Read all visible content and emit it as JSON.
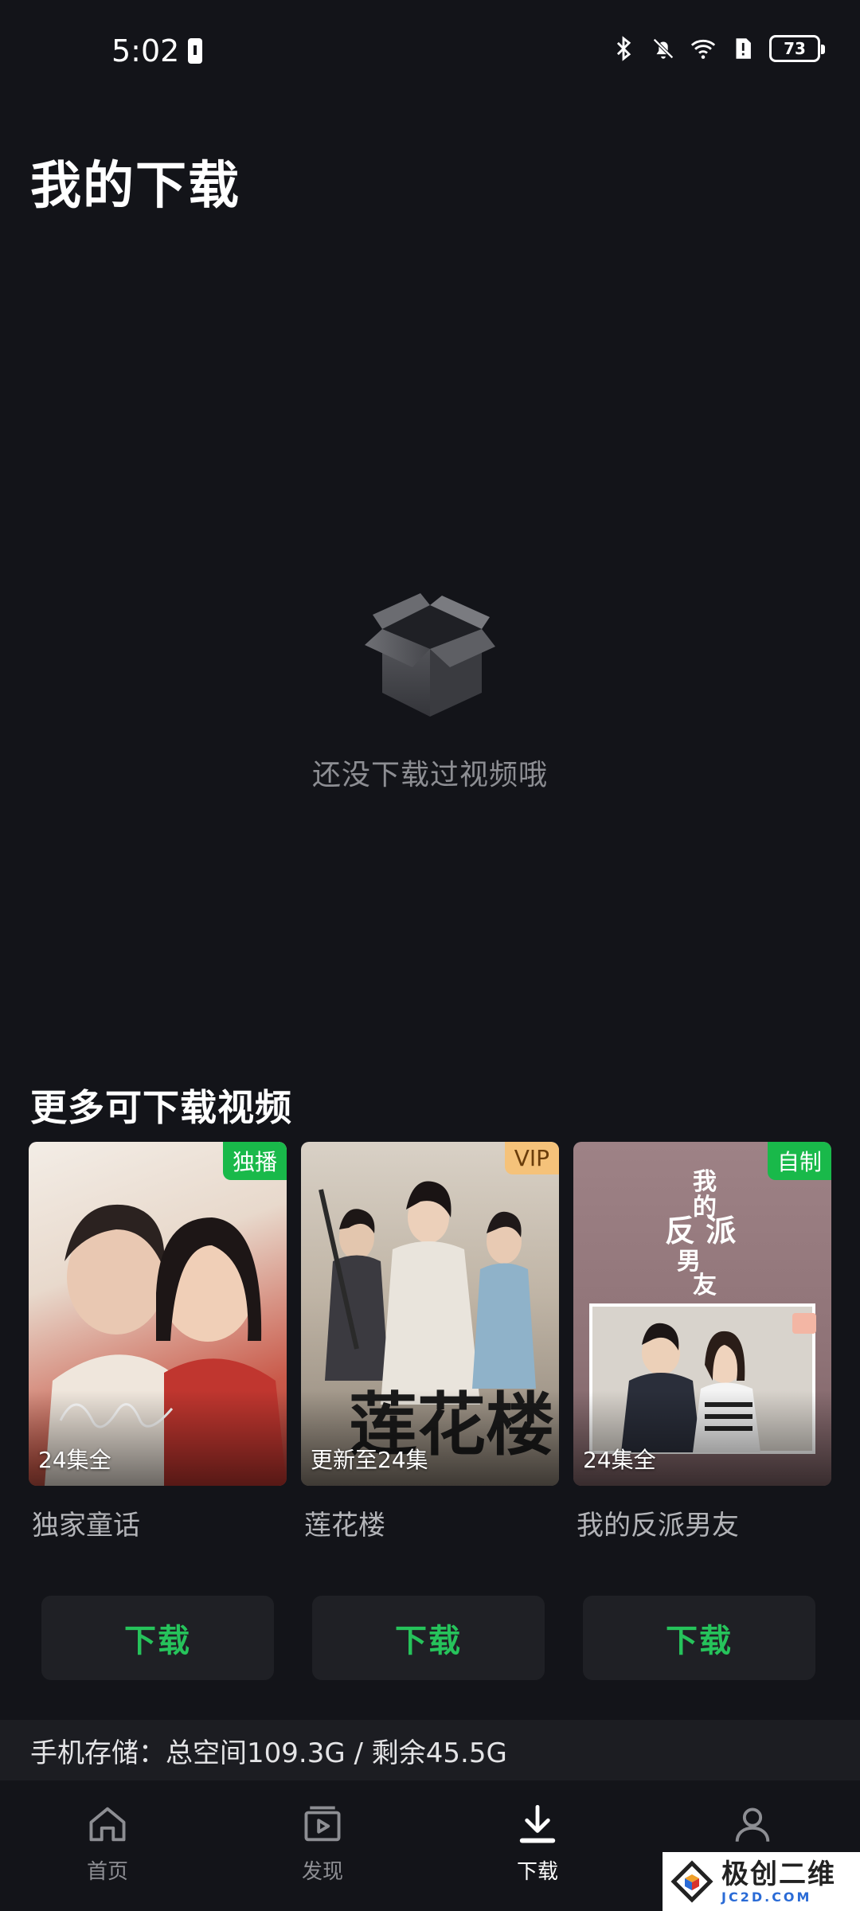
{
  "status": {
    "time": "5:02",
    "battery": "73"
  },
  "page": {
    "title": "我的下载"
  },
  "empty": {
    "message": "还没下载过视频哦"
  },
  "section": {
    "title": "更多可下载视频"
  },
  "cards": [
    {
      "title": "独家童话",
      "badge": "独播",
      "badge_color": "#19b94a",
      "episodes": "24集全"
    },
    {
      "title": "莲花楼",
      "badge": "VIP",
      "badge_color": "#f5c27a",
      "episodes": "更新至24集"
    },
    {
      "title": "我的反派男友",
      "badge": "自制",
      "badge_color": "#19b94a",
      "episodes": "24集全"
    }
  ],
  "download_buttons": [
    "下载",
    "下载",
    "下载"
  ],
  "storage": {
    "text": "手机存储：总空间109.3G / 剩余45.5G"
  },
  "tabs": [
    {
      "label": "首页",
      "icon": "home-icon",
      "active": false
    },
    {
      "label": "发现",
      "icon": "play-square-icon",
      "active": false
    },
    {
      "label": "下载",
      "icon": "download-icon",
      "active": true
    },
    {
      "label": "",
      "icon": "profile-icon",
      "active": false
    }
  ],
  "watermark": {
    "main": "极创二维",
    "sub": "JC2D.COM"
  },
  "colors": {
    "background": "#131419",
    "accent_green": "#26c35b",
    "muted_text": "#8d8e93"
  }
}
